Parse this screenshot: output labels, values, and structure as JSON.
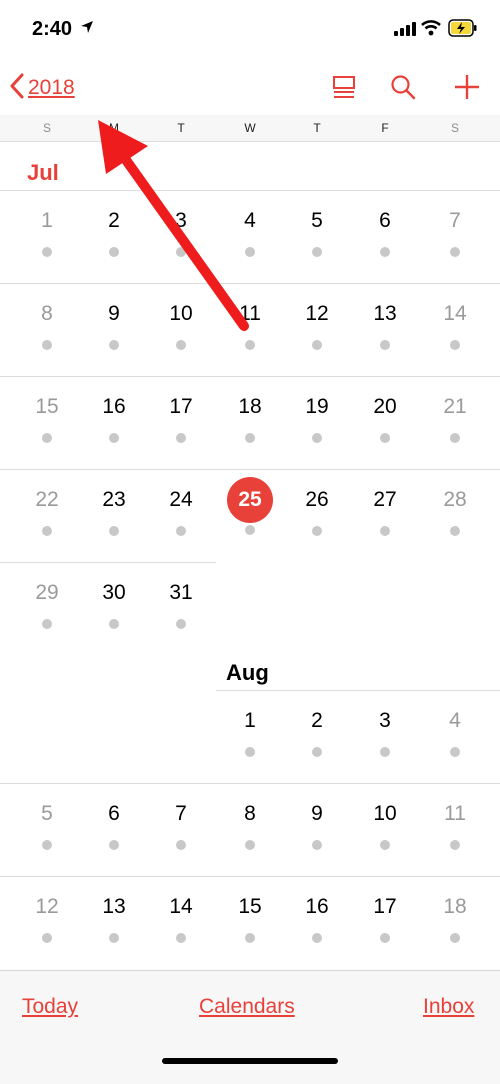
{
  "status_bar": {
    "time": "2:40"
  },
  "nav": {
    "back_label": "2018"
  },
  "weekdays": [
    "S",
    "M",
    "T",
    "W",
    "T",
    "F",
    "S"
  ],
  "months": [
    {
      "label": "Jul",
      "current": true
    },
    {
      "label": "Aug",
      "current": false
    }
  ],
  "calendar": {
    "today": "25",
    "rows": [
      [
        "1",
        "2",
        "3",
        "4",
        "5",
        "6",
        "7"
      ],
      [
        "8",
        "9",
        "10",
        "11",
        "12",
        "13",
        "14"
      ],
      [
        "15",
        "16",
        "17",
        "18",
        "19",
        "20",
        "21"
      ],
      [
        "22",
        "23",
        "24",
        "25",
        "26",
        "27",
        "28"
      ],
      [
        "29",
        "30",
        "31",
        "",
        "",
        "",
        ""
      ],
      [
        "",
        "",
        "",
        "1",
        "2",
        "3",
        "4"
      ],
      [
        "5",
        "6",
        "7",
        "8",
        "9",
        "10",
        "11"
      ],
      [
        "12",
        "13",
        "14",
        "15",
        "16",
        "17",
        "18"
      ]
    ]
  },
  "toolbar": {
    "today": "Today",
    "calendars": "Calendars",
    "inbox": "Inbox"
  },
  "colors": {
    "accent": "#e8413a",
    "dot": "#c8c8c8",
    "weekend_text": "#9a9a9a"
  }
}
